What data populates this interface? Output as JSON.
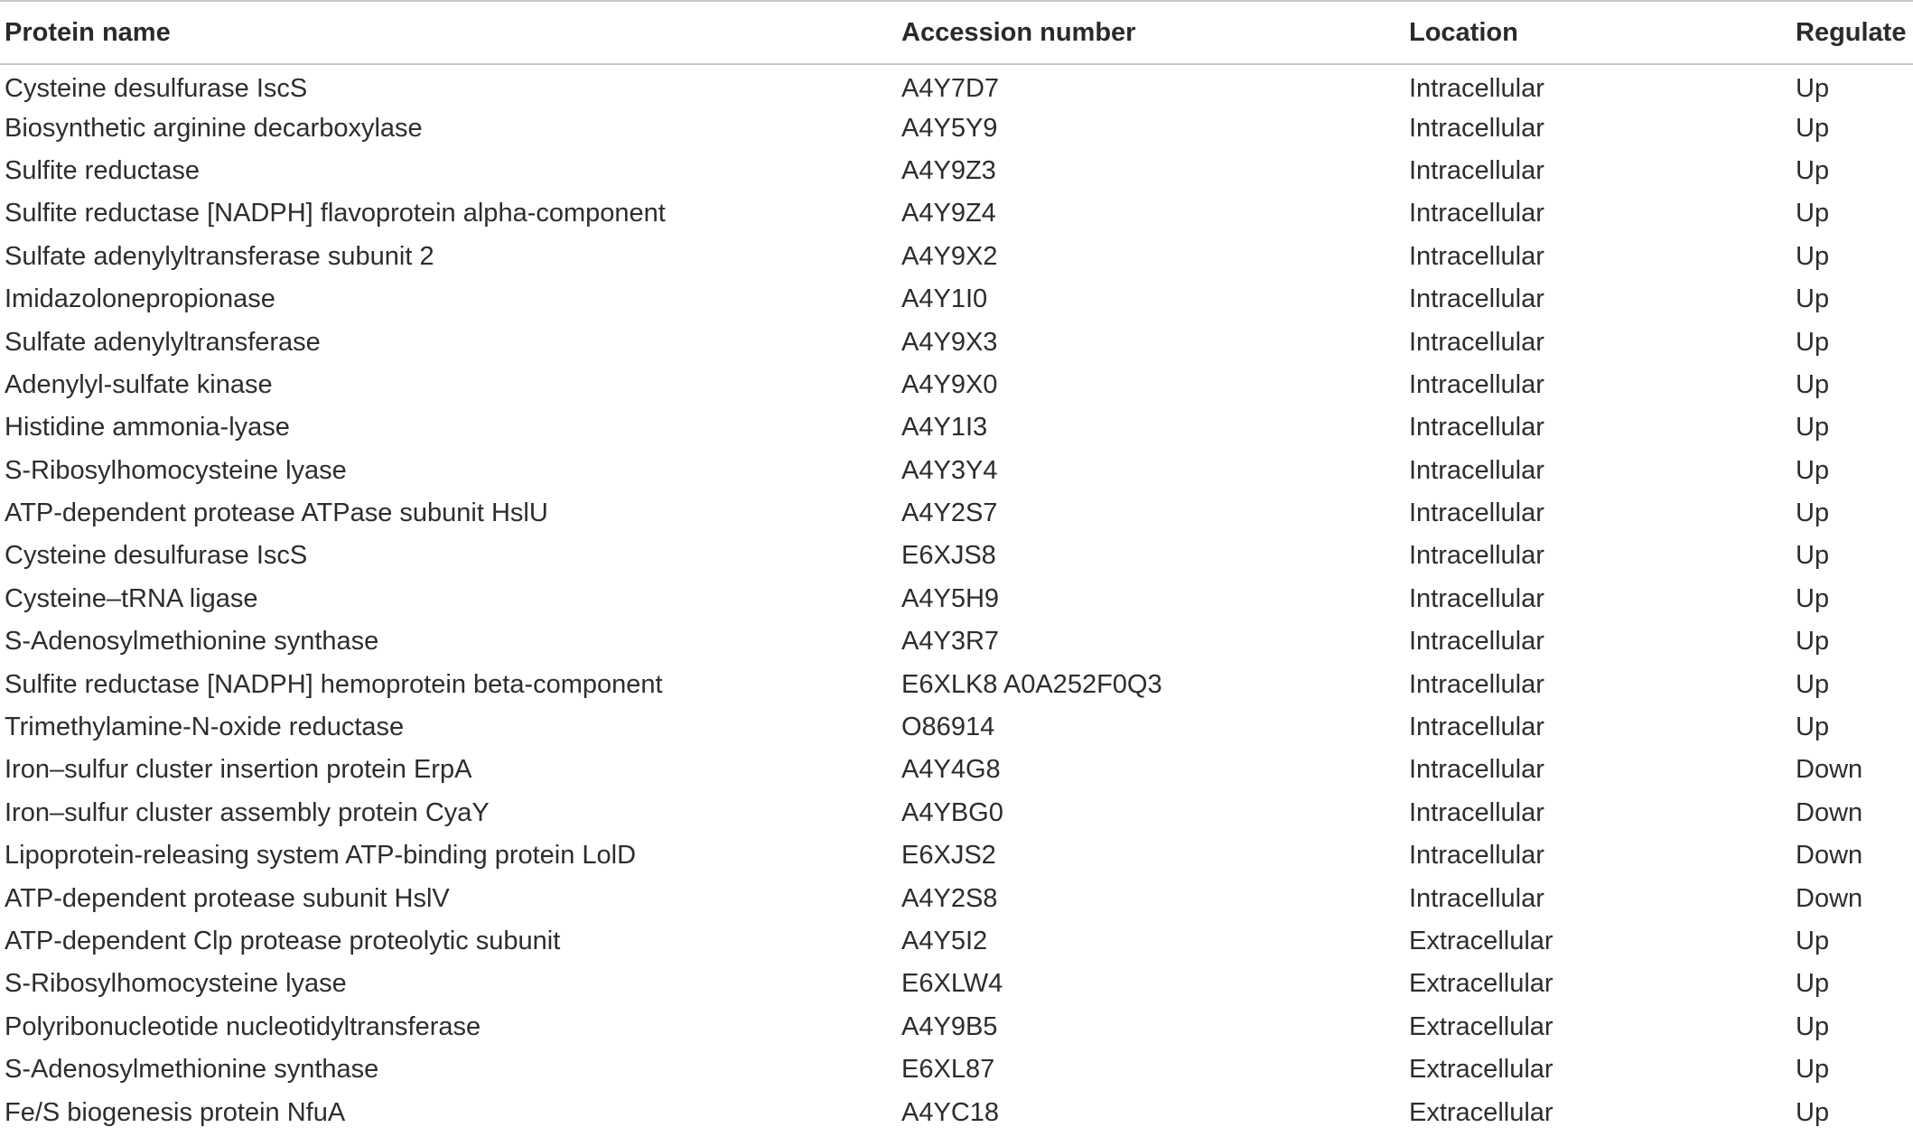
{
  "table": {
    "headers": [
      "Protein name",
      "Accession number",
      "Location",
      "Regulate"
    ],
    "rows": [
      [
        "Cysteine desulfurase IscS",
        "A4Y7D7",
        "Intracellular",
        "Up"
      ],
      [
        "Biosynthetic arginine decarboxylase",
        "A4Y5Y9",
        "Intracellular",
        "Up"
      ],
      [
        "Sulfite reductase",
        "A4Y9Z3",
        "Intracellular",
        "Up"
      ],
      [
        "Sulfite reductase [NADPH] flavoprotein alpha-component",
        "A4Y9Z4",
        "Intracellular",
        "Up"
      ],
      [
        "Sulfate adenylyltransferase subunit 2",
        "A4Y9X2",
        "Intracellular",
        "Up"
      ],
      [
        "Imidazolonepropionase",
        "A4Y1I0",
        "Intracellular",
        "Up"
      ],
      [
        "Sulfate adenylyltransferase",
        "A4Y9X3",
        "Intracellular",
        "Up"
      ],
      [
        "Adenylyl-sulfate kinase",
        "A4Y9X0",
        "Intracellular",
        "Up"
      ],
      [
        "Histidine ammonia-lyase",
        "A4Y1I3",
        "Intracellular",
        "Up"
      ],
      [
        "S-Ribosylhomocysteine lyase",
        "A4Y3Y4",
        "Intracellular",
        "Up"
      ],
      [
        "ATP-dependent protease ATPase subunit HslU",
        "A4Y2S7",
        "Intracellular",
        "Up"
      ],
      [
        "Cysteine desulfurase IscS",
        "E6XJS8",
        "Intracellular",
        "Up"
      ],
      [
        "Cysteine–tRNA ligase",
        "A4Y5H9",
        "Intracellular",
        "Up"
      ],
      [
        "S-Adenosylmethionine synthase",
        "A4Y3R7",
        "Intracellular",
        "Up"
      ],
      [
        "Sulfite reductase [NADPH] hemoprotein beta-component",
        "E6XLK8 A0A252F0Q3",
        "Intracellular",
        "Up"
      ],
      [
        "Trimethylamine-N-oxide reductase",
        "O86914",
        "Intracellular",
        "Up"
      ],
      [
        "Iron–sulfur cluster insertion protein ErpA",
        "A4Y4G8",
        "Intracellular",
        "Down"
      ],
      [
        "Iron–sulfur cluster assembly protein CyaY",
        "A4YBG0",
        "Intracellular",
        "Down"
      ],
      [
        "Lipoprotein-releasing system ATP-binding protein LolD",
        "E6XJS2",
        "Intracellular",
        "Down"
      ],
      [
        "ATP-dependent protease subunit HslV",
        "A4Y2S8",
        "Intracellular",
        "Down"
      ],
      [
        "ATP-dependent Clp protease proteolytic subunit",
        "A4Y5I2",
        "Extracellular",
        "Up"
      ],
      [
        "S-Ribosylhomocysteine lyase",
        "E6XLW4",
        "Extracellular",
        "Up"
      ],
      [
        "Polyribonucleotide nucleotidyltransferase",
        "A4Y9B5",
        "Extracellular",
        "Up"
      ],
      [
        "S-Adenosylmethionine synthase",
        "E6XL87",
        "Extracellular",
        "Up"
      ],
      [
        "Fe/S biogenesis protein NfuA",
        "A4YC18",
        "Extracellular",
        "Up"
      ]
    ]
  }
}
